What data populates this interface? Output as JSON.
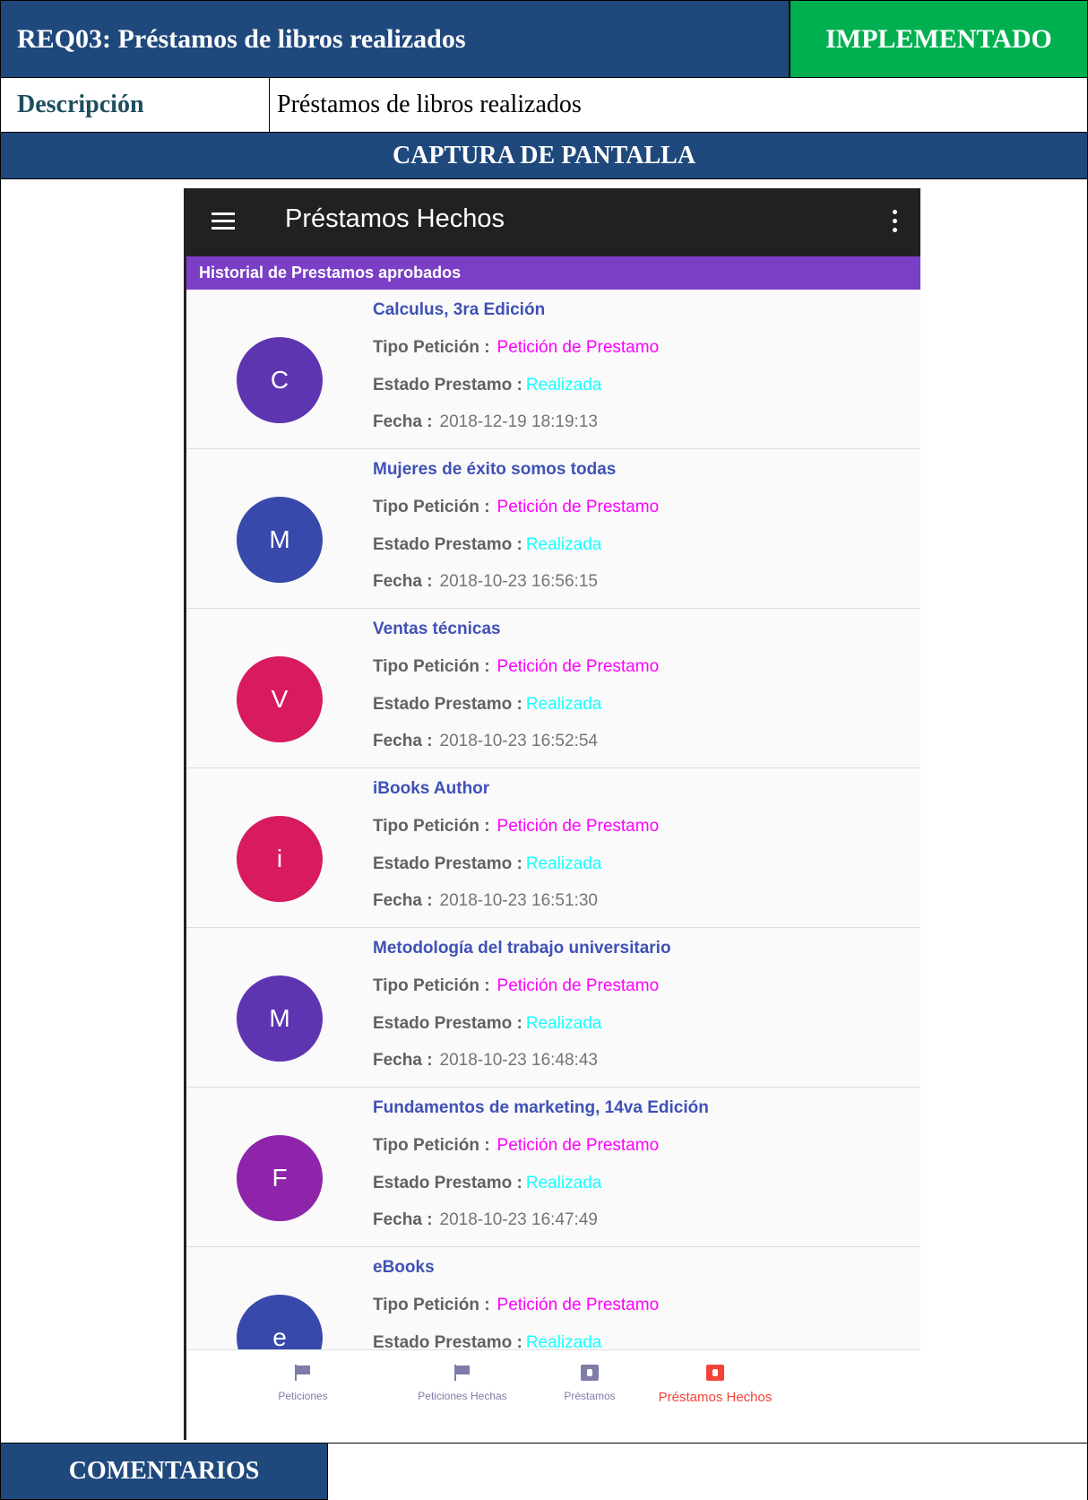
{
  "requirement": {
    "title": "REQ03: Préstamos de libros realizados",
    "status": "IMPLEMENTADO",
    "status_color": "#00b050",
    "header_color": "#1f497d"
  },
  "description": {
    "label": "Descripción",
    "value": "Préstamos de libros realizados"
  },
  "capture": {
    "header": "CAPTURA DE PANTALLA"
  },
  "comments": {
    "label": "COMENTARIOS",
    "value": ""
  },
  "app": {
    "title": "Préstamos Hechos",
    "subheader": "Historial de Prestamos aprobados",
    "subheader_color": "#7b3fc7",
    "labels": {
      "tipo": "Tipo Petición :",
      "estado": "Estado Prestamo :",
      "fecha": "Fecha :"
    },
    "items": [
      {
        "initial": "C",
        "avatar_color": "#5e35b1",
        "title": "Calculus, 3ra Edición",
        "tipo": "Petición de Prestamo",
        "estado": "Realizada",
        "fecha": "2018-12-19 18:19:13"
      },
      {
        "initial": "M",
        "avatar_color": "#3949ab",
        "title": "Mujeres de éxito somos todas",
        "tipo": "Petición de Prestamo",
        "estado": "Realizada",
        "fecha": "2018-10-23 16:56:15"
      },
      {
        "initial": "V",
        "avatar_color": "#d81b60",
        "title": "Ventas técnicas",
        "tipo": "Petición de Prestamo",
        "estado": "Realizada",
        "fecha": "2018-10-23 16:52:54"
      },
      {
        "initial": "i",
        "avatar_color": "#d81b60",
        "title": "iBooks Author",
        "tipo": "Petición de Prestamo",
        "estado": "Realizada",
        "fecha": "2018-10-23 16:51:30"
      },
      {
        "initial": "M",
        "avatar_color": "#5e35b1",
        "title": "Metodología del trabajo universitario",
        "tipo": "Petición de Prestamo",
        "estado": "Realizada",
        "fecha": "2018-10-23 16:48:43"
      },
      {
        "initial": "F",
        "avatar_color": "#8e24aa",
        "title": "Fundamentos de marketing, 14va Edición",
        "tipo": "Petición de Prestamo",
        "estado": "Realizada",
        "fecha": "2018-10-23 16:47:49"
      },
      {
        "initial": "e",
        "avatar_color": "#3949ab",
        "title": "eBooks",
        "tipo": "Petición de Prestamo",
        "estado": "Realizada",
        "fecha": ""
      }
    ],
    "bottom_nav": [
      {
        "label": "Peticiones",
        "icon": "flag-icon"
      },
      {
        "label": "Peticiones Hechas",
        "icon": "flag-icon"
      },
      {
        "label": "Préstamos",
        "icon": "folder-user-icon"
      },
      {
        "label": "Préstamos Hechos",
        "icon": "folder-user-icon",
        "active": true
      }
    ]
  }
}
